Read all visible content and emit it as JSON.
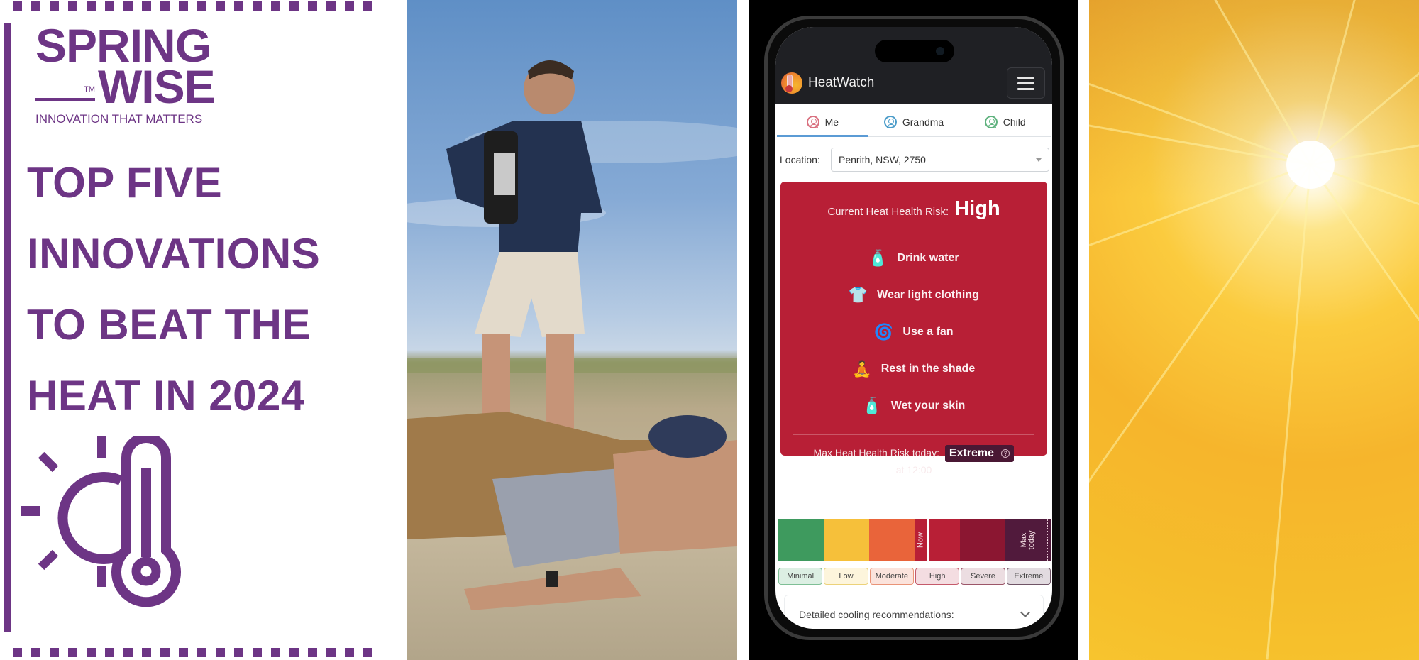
{
  "brand": {
    "logo_line1": "SPRING",
    "logo_line2": "WISE",
    "trademark": "TM",
    "tagline": "INNOVATION THAT MATTERS",
    "accent_color": "#6d3585"
  },
  "headline": {
    "lines": [
      "TOP FIVE",
      "INNOVATIONS",
      "TO BEAT THE",
      "HEAT IN 2024"
    ]
  },
  "icons": {
    "left_panel": "sun-thermometer-icon",
    "photo": "cooling-vest-photo",
    "sun": "sun-flare-image"
  },
  "app": {
    "name": "HeatWatch",
    "menu_icon": "hamburger-icon",
    "tabs": [
      {
        "label": "Me",
        "color": "#d9707f",
        "active": true
      },
      {
        "label": "Grandma",
        "color": "#4b9cc9",
        "active": false
      },
      {
        "label": "Child",
        "color": "#5fb27e",
        "active": false
      }
    ],
    "location": {
      "label": "Location:",
      "value": "Penrith, NSW, 2750"
    },
    "risk": {
      "label": "Current Heat Health Risk:",
      "value": "High",
      "card_color": "#b81f36"
    },
    "recommendations": [
      {
        "icon": "water-bottle-icon",
        "emoji": "🧴",
        "label": "Drink water"
      },
      {
        "icon": "tshirt-icon",
        "emoji": "👕",
        "label": "Wear light clothing"
      },
      {
        "icon": "fan-icon",
        "emoji": "🌀",
        "label": "Use a fan"
      },
      {
        "icon": "person-shade-icon",
        "emoji": "🧘",
        "label": "Rest in the shade"
      },
      {
        "icon": "spray-bottle-icon",
        "emoji": "🧴",
        "label": "Wet your skin"
      }
    ],
    "max_risk": {
      "label": "Max Heat Health Risk today:",
      "value": "Extreme",
      "help": "?",
      "time": "at 12:00"
    },
    "scale": {
      "now_label": "Now",
      "max_label_line1": "Max",
      "max_label_line2": "today",
      "levels": [
        {
          "label": "Minimal",
          "color": "#3e9a5e",
          "chip_bg": "#dcefe3",
          "chip_border": "#7fbf96"
        },
        {
          "label": "Low",
          "color": "#f6c03a",
          "chip_bg": "#fdf5dc",
          "chip_border": "#ecd27a"
        },
        {
          "label": "Moderate",
          "color": "#e9643a",
          "chip_bg": "#fbe3dc",
          "chip_border": "#e99478"
        },
        {
          "label": "High",
          "color": "#b81f36",
          "chip_bg": "#f4dde1",
          "chip_border": "#c55a6b"
        },
        {
          "label": "Severe",
          "color": "#8b1631",
          "chip_bg": "#ecdde1",
          "chip_border": "#9c5669"
        },
        {
          "label": "Extreme",
          "color": "#511a3c",
          "chip_bg": "#e2dbe0",
          "chip_border": "#6f5466"
        }
      ],
      "current_level_index": 3,
      "max_level_index": 5
    },
    "accordion": {
      "label": "Detailed cooling recommendations:"
    }
  }
}
